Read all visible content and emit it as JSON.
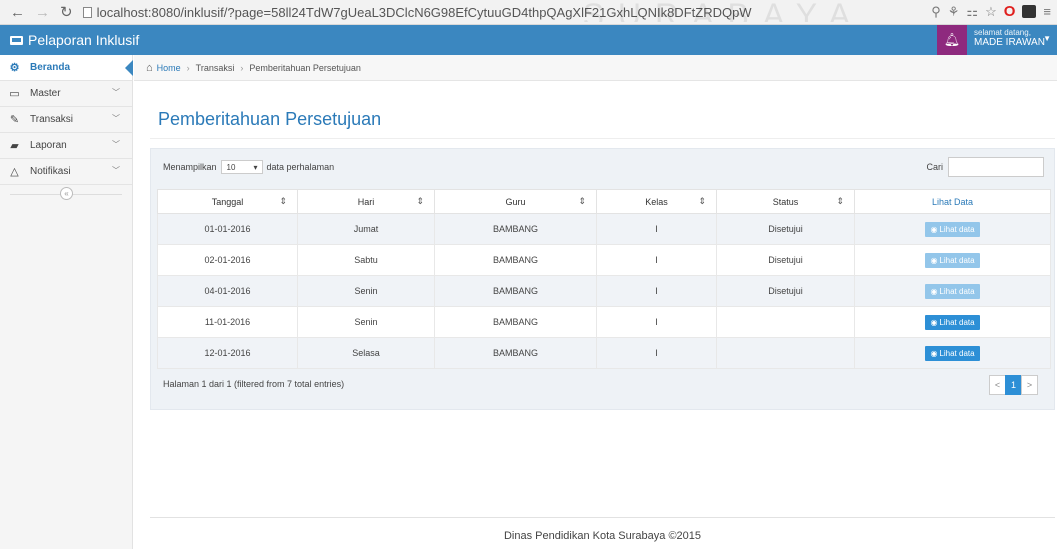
{
  "browser": {
    "url": "localhost:8080/inklusif/?page=58ll24TdW7gUeaL3DClcN6G98EfCytuuGD4thpQAgXlF21GxhLQNIk8DFtZRDQpW",
    "watermark": "SURABAYA"
  },
  "header": {
    "brand": "Pelaporan Inklusif",
    "greeting": "selamat datang,",
    "user": "MADE IRAWAN"
  },
  "sidebar": {
    "items": [
      {
        "label": "Beranda",
        "icon": "dashboard-icon"
      },
      {
        "label": "Master",
        "icon": "monitor-icon"
      },
      {
        "label": "Transaksi",
        "icon": "edit-icon"
      },
      {
        "label": "Laporan",
        "icon": "book-icon"
      },
      {
        "label": "Notifikasi",
        "icon": "bell-icon"
      }
    ]
  },
  "breadcrumb": {
    "home": "Home",
    "transaksi": "Transaksi",
    "current": "Pemberitahuan Persetujuan"
  },
  "page": {
    "title": "Pemberitahuan Persetujuan",
    "length_prefix": "Menampilkan",
    "length_value": "10",
    "length_suffix": "data perhalaman",
    "search_label": "Cari",
    "search_value": ""
  },
  "table": {
    "columns": [
      "Tanggal",
      "Hari",
      "Guru",
      "Kelas",
      "Status",
      "Lihat Data"
    ],
    "rows": [
      {
        "tanggal": "01-01-2016",
        "hari": "Jumat",
        "guru": "BAMBANG",
        "kelas": "I",
        "status": "Disetujui",
        "action": "Lihat data",
        "enabled": false
      },
      {
        "tanggal": "02-01-2016",
        "hari": "Sabtu",
        "guru": "BAMBANG",
        "kelas": "I",
        "status": "Disetujui",
        "action": "Lihat data",
        "enabled": false
      },
      {
        "tanggal": "04-01-2016",
        "hari": "Senin",
        "guru": "BAMBANG",
        "kelas": "I",
        "status": "Disetujui",
        "action": "Lihat data",
        "enabled": false
      },
      {
        "tanggal": "11-01-2016",
        "hari": "Senin",
        "guru": "BAMBANG",
        "kelas": "I",
        "status": "",
        "action": "Lihat data",
        "enabled": true
      },
      {
        "tanggal": "12-01-2016",
        "hari": "Selasa",
        "guru": "BAMBANG",
        "kelas": "I",
        "status": "",
        "action": "Lihat data",
        "enabled": true
      }
    ],
    "info": "Halaman 1 dari 1 (filtered from 7 total entries)"
  },
  "pagination": {
    "prev": "<",
    "current": "1",
    "next": ">"
  },
  "footer": {
    "text": "Dinas Pendidikan Kota Surabaya ©2015"
  },
  "colors": {
    "header": "#3b87c0",
    "bell": "#8e2a7e",
    "button": "#2d8fd6",
    "button_disabled": "#93c6ea"
  }
}
